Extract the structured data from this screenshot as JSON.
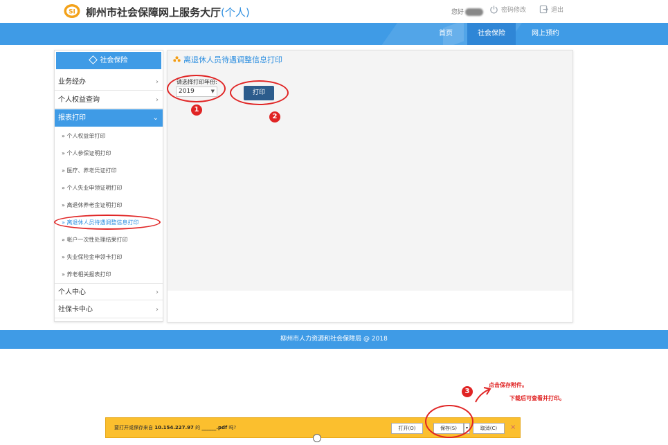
{
  "header": {
    "title_main": "柳州市社会保障网上服务大厅",
    "title_sub": "(个人)",
    "greeting": "您好",
    "password_change": "密码修改",
    "logout": "退出"
  },
  "nav": {
    "home": "首页",
    "social_insurance": "社会保险",
    "appointment": "网上预约"
  },
  "sidebar": {
    "head": "社会保险",
    "items": [
      {
        "label": "业务经办",
        "arrow": "›"
      },
      {
        "label": "个人权益查询",
        "arrow": "›"
      },
      {
        "label": "报表打印",
        "arrow": "⌄"
      }
    ],
    "subitems": [
      "» 个人权益单打印",
      "» 个人参保证明打印",
      "» 医疗、养老凭证打印",
      "» 个人失业申领证明打印",
      "» 离退休养老金证明打印",
      "» 离退休人员待遇调整信息打印",
      "» 帐户一次性处理结果打印",
      "» 失业保险金申领卡打印",
      "» 养老相关报表打印"
    ],
    "bottom_items": [
      {
        "label": "个人中心",
        "arrow": "›"
      },
      {
        "label": "社保卡中心",
        "arrow": "›"
      }
    ]
  },
  "content": {
    "title": "离退休人员待遇调整信息打印",
    "year_label": "请选择打印年份:",
    "year_value": "2019",
    "print_button": "打印"
  },
  "footer": {
    "text": "柳州市人力资源和社会保障局 @ 2018"
  },
  "download_bar": {
    "prefix": "要打开或保存来自",
    "host": "10.154.227.97",
    "mid": "的",
    "filename": "______.pdf",
    "suffix": "吗?",
    "open": "打开(O)",
    "save": "保存(S)",
    "save_arrow": "▾",
    "cancel": "取消(C)",
    "close": "×"
  },
  "annotations": {
    "n1": "1",
    "n2": "2",
    "n3": "3",
    "note1": "点击保存附件。",
    "note2": "下载后可查看并打印。"
  },
  "colors": {
    "primary": "#3f9be6",
    "button": "#2c5c8c",
    "annotation": "#e02424",
    "download_bar": "#fbbf2e"
  }
}
